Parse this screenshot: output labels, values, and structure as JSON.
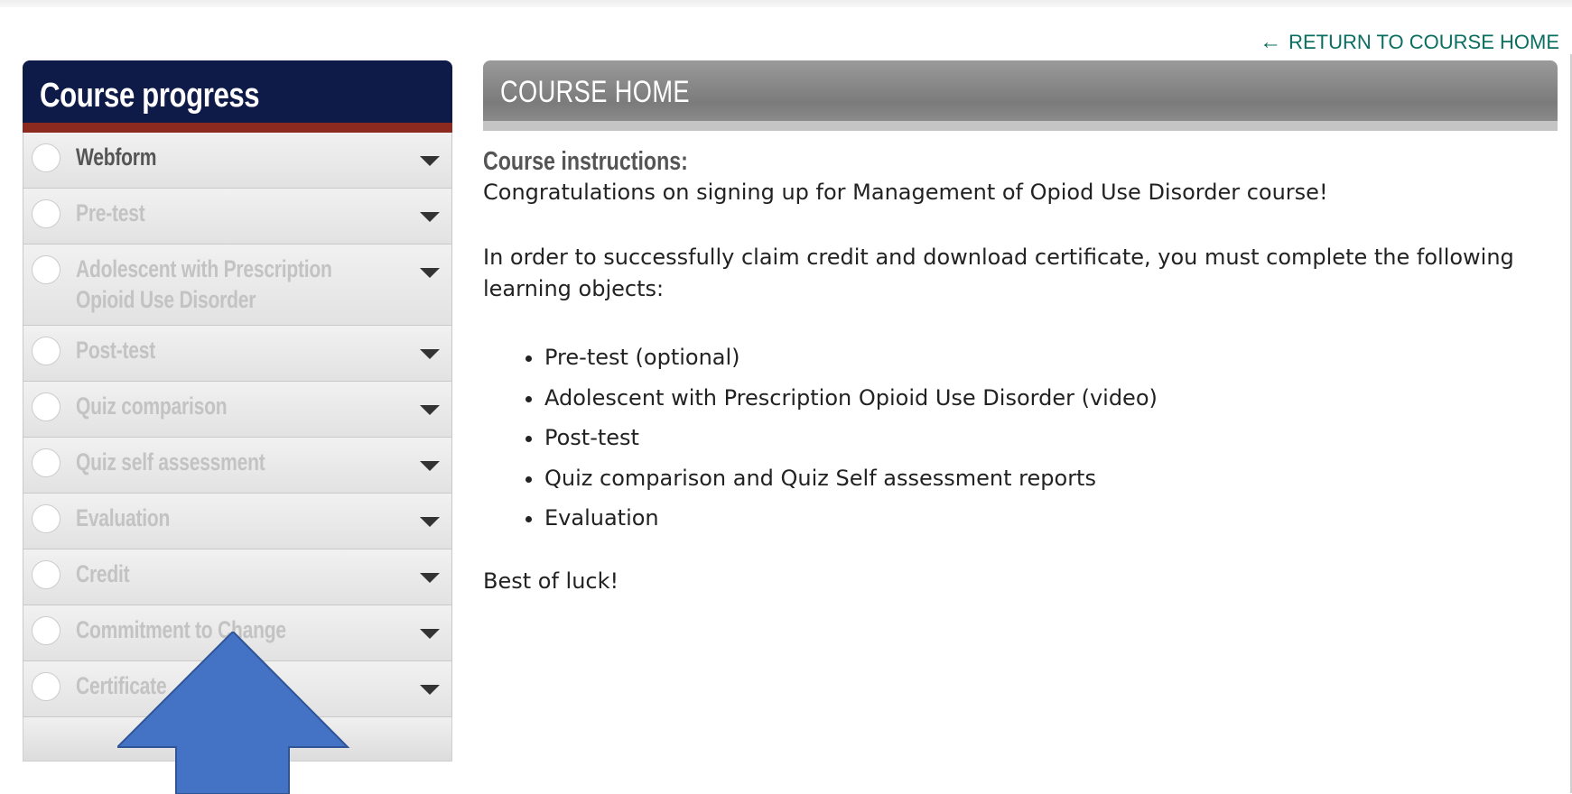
{
  "header": {
    "return_link": "RETURN TO COURSE HOME"
  },
  "sidebar": {
    "title": "Course progress",
    "items": [
      {
        "label": "Webform"
      },
      {
        "label": "Pre-test"
      },
      {
        "label": "Adolescent with Prescription Opioid Use Disorder"
      },
      {
        "label": "Post-test"
      },
      {
        "label": "Quiz comparison"
      },
      {
        "label": "Quiz self assessment"
      },
      {
        "label": "Evaluation"
      },
      {
        "label": "Credit"
      },
      {
        "label": "Commitment to Change"
      },
      {
        "label": "Certificate"
      }
    ]
  },
  "main": {
    "title": "COURSE HOME",
    "instructions_heading": "Course instructions:",
    "intro": "Congratulations on signing up for Management of Opiod Use Disorder course!",
    "requirement": "In order to successfully claim credit and download certificate, you must complete the following learning objects:",
    "objectives": [
      "Pre-test (optional)",
      "Adolescent with Prescription Opioid Use Disorder (video)",
      "Post-test",
      "Quiz comparison and Quiz Self assessment reports",
      "Evaluation"
    ],
    "closing": "Best of luck!"
  },
  "colors": {
    "sidebar_header": "#0e1a47",
    "sidebar_accent": "#8c2a20",
    "link": "#0a6e61",
    "overlay_arrow": "#4472c4"
  },
  "icons": {
    "return": "arrow-left-icon",
    "expand": "caret-down-icon",
    "status": "circle-icon"
  }
}
